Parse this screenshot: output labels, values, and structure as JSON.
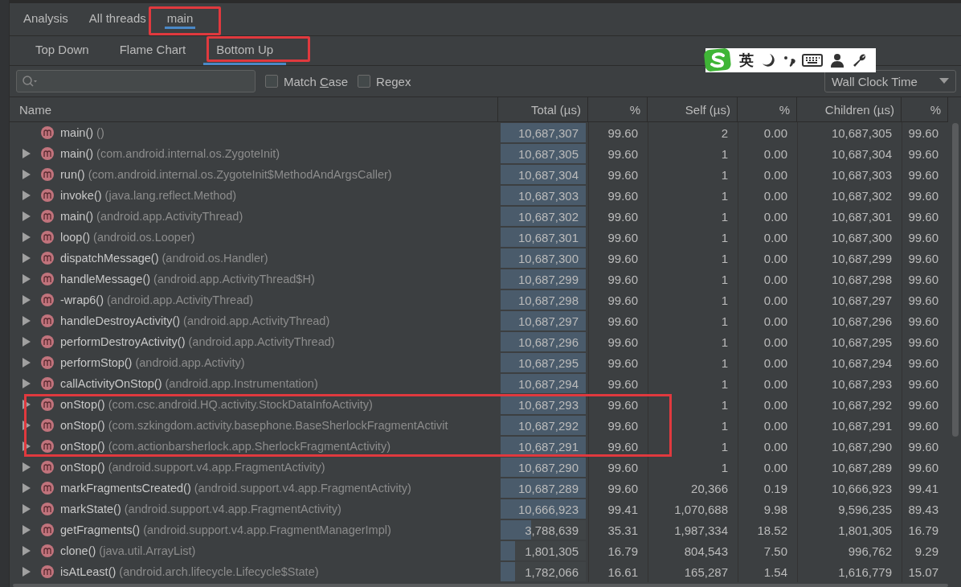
{
  "thread_tabs": [
    {
      "label": "Analysis",
      "selected": false,
      "annotated": false
    },
    {
      "label": "All threads",
      "selected": false,
      "annotated": false
    },
    {
      "label": "main",
      "selected": true,
      "annotated": true
    }
  ],
  "view_tabs": [
    {
      "label": "Top Down",
      "selected": false,
      "annotated": false
    },
    {
      "label": "Flame Chart",
      "selected": false,
      "annotated": false
    },
    {
      "label": "Bottom Up",
      "selected": true,
      "annotated": true
    }
  ],
  "ime_toolbar": {
    "label": "英"
  },
  "options": [
    {
      "label": "Match Case",
      "checked": false
    },
    {
      "label": "Regex",
      "checked": false
    }
  ],
  "clock_dropdown": {
    "value": "Wall Clock Time"
  },
  "table": {
    "columns": [
      "Name",
      "Total (µs)",
      "%",
      "Self (µs)",
      "%",
      "Children (µs)",
      "%"
    ],
    "rows": [
      {
        "method": "main()",
        "class": "()",
        "expandable": false,
        "highlighted": false,
        "total": "10,687,307",
        "level": 1.0,
        "total_pct": "99.60",
        "self": "2",
        "self_pct": "0.00",
        "children": "10,687,305",
        "children_pct": "99.60"
      },
      {
        "method": "main()",
        "class": "(com.android.internal.os.ZygoteInit)",
        "expandable": true,
        "highlighted": false,
        "total": "10,687,305",
        "level": 1.0,
        "total_pct": "99.60",
        "self": "1",
        "self_pct": "0.00",
        "children": "10,687,304",
        "children_pct": "99.60"
      },
      {
        "method": "run()",
        "class": "(com.android.internal.os.ZygoteInit$MethodAndArgsCaller)",
        "expandable": true,
        "highlighted": false,
        "total": "10,687,304",
        "level": 1.0,
        "total_pct": "99.60",
        "self": "1",
        "self_pct": "0.00",
        "children": "10,687,303",
        "children_pct": "99.60"
      },
      {
        "method": "invoke()",
        "class": "(java.lang.reflect.Method)",
        "expandable": true,
        "highlighted": false,
        "total": "10,687,303",
        "level": 1.0,
        "total_pct": "99.60",
        "self": "1",
        "self_pct": "0.00",
        "children": "10,687,302",
        "children_pct": "99.60"
      },
      {
        "method": "main()",
        "class": "(android.app.ActivityThread)",
        "expandable": true,
        "highlighted": false,
        "total": "10,687,302",
        "level": 1.0,
        "total_pct": "99.60",
        "self": "1",
        "self_pct": "0.00",
        "children": "10,687,301",
        "children_pct": "99.60"
      },
      {
        "method": "loop()",
        "class": "(android.os.Looper)",
        "expandable": true,
        "highlighted": false,
        "total": "10,687,301",
        "level": 1.0,
        "total_pct": "99.60",
        "self": "1",
        "self_pct": "0.00",
        "children": "10,687,300",
        "children_pct": "99.60"
      },
      {
        "method": "dispatchMessage()",
        "class": "(android.os.Handler)",
        "expandable": true,
        "highlighted": false,
        "total": "10,687,300",
        "level": 1.0,
        "total_pct": "99.60",
        "self": "1",
        "self_pct": "0.00",
        "children": "10,687,299",
        "children_pct": "99.60"
      },
      {
        "method": "handleMessage()",
        "class": "(android.app.ActivityThread$H)",
        "expandable": true,
        "highlighted": false,
        "total": "10,687,299",
        "level": 1.0,
        "total_pct": "99.60",
        "self": "1",
        "self_pct": "0.00",
        "children": "10,687,298",
        "children_pct": "99.60"
      },
      {
        "method": "-wrap6()",
        "class": "(android.app.ActivityThread)",
        "expandable": true,
        "highlighted": false,
        "total": "10,687,298",
        "level": 1.0,
        "total_pct": "99.60",
        "self": "1",
        "self_pct": "0.00",
        "children": "10,687,297",
        "children_pct": "99.60"
      },
      {
        "method": "handleDestroyActivity()",
        "class": "(android.app.ActivityThread)",
        "expandable": true,
        "highlighted": false,
        "total": "10,687,297",
        "level": 1.0,
        "total_pct": "99.60",
        "self": "1",
        "self_pct": "0.00",
        "children": "10,687,296",
        "children_pct": "99.60"
      },
      {
        "method": "performDestroyActivity()",
        "class": "(android.app.ActivityThread)",
        "expandable": true,
        "highlighted": false,
        "total": "10,687,296",
        "level": 1.0,
        "total_pct": "99.60",
        "self": "1",
        "self_pct": "0.00",
        "children": "10,687,295",
        "children_pct": "99.60"
      },
      {
        "method": "performStop()",
        "class": "(android.app.Activity)",
        "expandable": true,
        "highlighted": false,
        "total": "10,687,295",
        "level": 1.0,
        "total_pct": "99.60",
        "self": "1",
        "self_pct": "0.00",
        "children": "10,687,294",
        "children_pct": "99.60"
      },
      {
        "method": "callActivityOnStop()",
        "class": "(android.app.Instrumentation)",
        "expandable": true,
        "highlighted": false,
        "total": "10,687,294",
        "level": 1.0,
        "total_pct": "99.60",
        "self": "1",
        "self_pct": "0.00",
        "children": "10,687,293",
        "children_pct": "99.60"
      },
      {
        "method": "onStop()",
        "class": "(com.csc.android.HQ.activity.StockDataInfoActivity)",
        "expandable": true,
        "highlighted": true,
        "total": "10,687,293",
        "level": 1.0,
        "total_pct": "99.60",
        "self": "1",
        "self_pct": "0.00",
        "children": "10,687,292",
        "children_pct": "99.60"
      },
      {
        "method": "onStop()",
        "class": "(com.szkingdom.activity.basephone.BaseSherlockFragmentActivit",
        "expandable": true,
        "highlighted": true,
        "total": "10,687,292",
        "level": 1.0,
        "total_pct": "99.60",
        "self": "1",
        "self_pct": "0.00",
        "children": "10,687,291",
        "children_pct": "99.60"
      },
      {
        "method": "onStop()",
        "class": "(com.actionbarsherlock.app.SherlockFragmentActivity)",
        "expandable": true,
        "highlighted": true,
        "total": "10,687,291",
        "level": 1.0,
        "total_pct": "99.60",
        "self": "1",
        "self_pct": "0.00",
        "children": "10,687,290",
        "children_pct": "99.60"
      },
      {
        "method": "onStop()",
        "class": "(android.support.v4.app.FragmentActivity)",
        "expandable": true,
        "highlighted": false,
        "total": "10,687,290",
        "level": 1.0,
        "total_pct": "99.60",
        "self": "1",
        "self_pct": "0.00",
        "children": "10,687,289",
        "children_pct": "99.60"
      },
      {
        "method": "markFragmentsCreated()",
        "class": "(android.support.v4.app.FragmentActivity)",
        "expandable": true,
        "highlighted": false,
        "total": "10,687,289",
        "level": 1.0,
        "total_pct": "99.60",
        "self": "20,366",
        "self_pct": "0.19",
        "children": "10,666,923",
        "children_pct": "99.41"
      },
      {
        "method": "markState()",
        "class": "(android.support.v4.app.FragmentActivity)",
        "expandable": true,
        "highlighted": false,
        "total": "10,666,923",
        "level": 0.998,
        "total_pct": "99.41",
        "self": "1,070,688",
        "self_pct": "9.98",
        "children": "9,596,235",
        "children_pct": "89.43"
      },
      {
        "method": "getFragments()",
        "class": "(android.support.v4.app.FragmentManagerImpl)",
        "expandable": true,
        "highlighted": false,
        "total": "3,788,639",
        "level": 0.354,
        "total_pct": "35.31",
        "self": "1,987,334",
        "self_pct": "18.52",
        "children": "1,801,305",
        "children_pct": "16.79"
      },
      {
        "method": "clone()",
        "class": "(java.util.ArrayList)",
        "expandable": true,
        "highlighted": false,
        "total": "1,801,305",
        "level": 0.169,
        "total_pct": "16.79",
        "self": "804,543",
        "self_pct": "7.50",
        "children": "996,762",
        "children_pct": "9.29"
      },
      {
        "method": "isAtLeast()",
        "class": "(android.arch.lifecycle.Lifecycle$State)",
        "expandable": true,
        "highlighted": false,
        "total": "1,782,066",
        "level": 0.167,
        "total_pct": "16.61",
        "self": "165,287",
        "self_pct": "1.54",
        "children": "1,616,779",
        "children_pct": "15.07"
      }
    ]
  }
}
